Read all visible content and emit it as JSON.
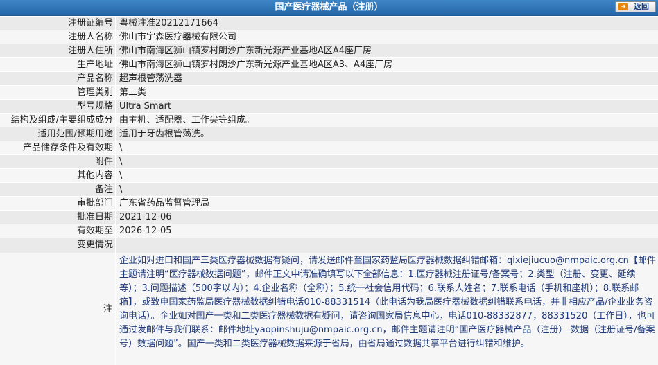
{
  "header": {
    "title": "国产医疗器械产品（注册）",
    "back_label": "返回"
  },
  "fields": [
    {
      "label": "注册证编号",
      "value": "粤械注准20212171664"
    },
    {
      "label": "注册人名称",
      "value": "佛山市宇森医疗器械有限公司"
    },
    {
      "label": "注册人住所",
      "value": "佛山市南海区狮山镇罗村朗沙广东新光源产业基地A区A4座厂房"
    },
    {
      "label": "生产地址",
      "value": "佛山市南海区狮山镇罗村朗沙广东新光源产业基地A区A3、A4座厂房"
    },
    {
      "label": "产品名称",
      "value": "超声根管荡洗器"
    },
    {
      "label": "管理类别",
      "value": "第二类"
    },
    {
      "label": "型号规格",
      "value": "Ultra Smart"
    },
    {
      "label": "结构及组成/主要组成成分",
      "value": "由主机、适配器、工作尖等组成。"
    },
    {
      "label": "适用范围/预期用途",
      "value": "适用于牙齿根管荡洗。"
    },
    {
      "label": "产品储存条件及有效期",
      "value": "\\"
    },
    {
      "label": "附件",
      "value": "\\"
    },
    {
      "label": "其他内容",
      "value": "\\"
    },
    {
      "label": "备注",
      "value": "\\"
    },
    {
      "label": "审批部门",
      "value": "广东省药品监督管理局"
    },
    {
      "label": "批准日期",
      "value": "2021-12-06"
    },
    {
      "label": "有效期至",
      "value": "2026-12-05"
    }
  ],
  "change": {
    "label": "变更情况",
    "value": ""
  },
  "note": {
    "label": "注",
    "text": "企业如对进口和国产三类医疗器械数据有疑问，请发送邮件至国家药监局医疗器械数据纠错邮箱：qixiejiucuo@nmpaic.org.cn【邮件主题请注明“医疗器械数据问题”，邮件正文中请准确填写以下全部信息：1.医疗器械注册证号/备案号；2.类型（注册、变更、延续等）；3.问题描述（500字以内）；4.企业名称（全称）；5.统一社会信用代码；6.联系人姓名；7.联系电话（手机和座机）；8.联系邮箱】，或致电国家药监局医疗器械数据纠错电话010-88331514（此电话为我局医疗器械数据纠错联系电话，并非相应产品/企业业务咨询电话）。企业如对国产一类和二类医疗器械数据有疑问，请咨询国家局信息中心，电话010-88332877，88331520（工作日），也可通过发邮件与我们联系：邮件地址yaopinshuju@nmpaic.org.cn，邮件主题请注明“国产医疗器械产品（注册）-数据（注册证号/备案号）数据问题”。国产一类和二类医疗器械数据来源于省局，由省局通过数据共享平台进行纠错和维护。"
  }
}
